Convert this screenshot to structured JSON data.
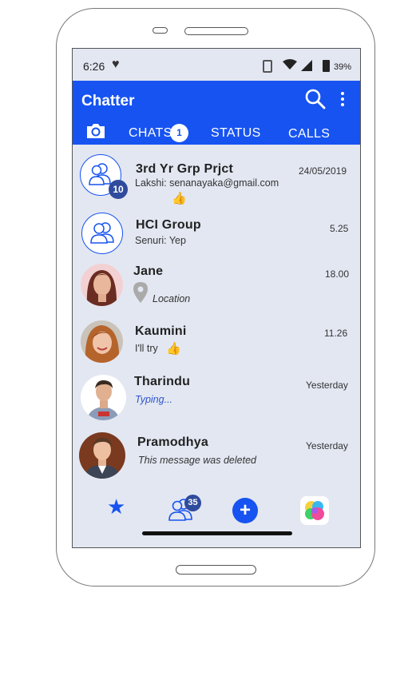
{
  "status_bar": {
    "time": "6:26",
    "battery": "39%"
  },
  "app": {
    "title": "Chatter",
    "accent_color": "#1753f0"
  },
  "tabs": [
    {
      "label": "CHATS",
      "badge": "1"
    },
    {
      "label": "STATUS"
    },
    {
      "label": "CALLS"
    }
  ],
  "chats": [
    {
      "name": "3rd Yr Grp Prjct",
      "time": "24/05/2019",
      "preview": "Lakshi: senanayaka@gmail.com",
      "badge": "10",
      "avatar": "group-icon",
      "extra": "thumbs-up"
    },
    {
      "name": "HCI Group",
      "time": "5.25",
      "preview": "Senuri: Yep",
      "avatar": "group-icon"
    },
    {
      "name": "Jane",
      "time": "18.00",
      "preview": "Location",
      "avatar": "photo",
      "extra": "location-pin"
    },
    {
      "name": "Kaumini",
      "time": "11.26",
      "preview": "I'll try",
      "avatar": "photo",
      "extra": "thumbs-up"
    },
    {
      "name": "Tharindu",
      "time": "Yesterday",
      "preview": "Typing...",
      "avatar": "photo"
    },
    {
      "name": "Pramodhya",
      "time": "Yesterday",
      "preview": "This message was deleted",
      "avatar": "photo"
    }
  ],
  "bottom_nav": {
    "contacts_badge": "35",
    "items": [
      "star-icon",
      "contacts-icon",
      "add-icon",
      "games-icon"
    ]
  }
}
